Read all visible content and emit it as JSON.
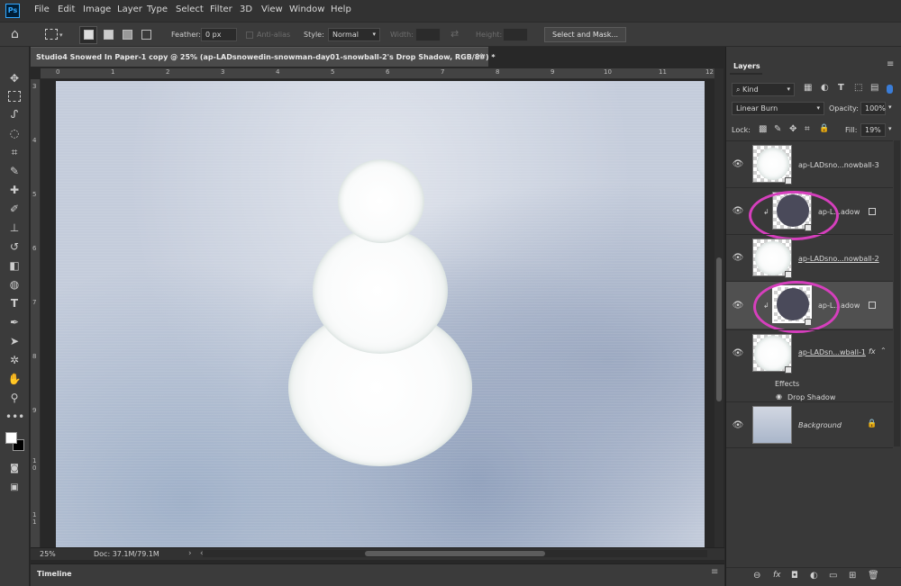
{
  "app": {
    "logo_text": "Ps",
    "menu": [
      "File",
      "Edit",
      "Image",
      "Layer",
      "Type",
      "Select",
      "Filter",
      "3D",
      "View",
      "Window",
      "Help"
    ]
  },
  "options_bar": {
    "feather_label": "Feather:",
    "feather_value": "0 px",
    "antialias_label": "Anti-alias",
    "style_label": "Style:",
    "style_value": "Normal",
    "width_label": "Width:",
    "height_label": "Height:",
    "select_mask_label": "Select and Mask..."
  },
  "document": {
    "tab_title": "Studio4 Snowed In Paper-1 copy @ 25% (ap-LADsnowedin-snowman-day01-snowball-2's Drop Shadow, RGB/8#) *",
    "close_glyph": "×",
    "h_ruler_ticks": [
      "0",
      "1",
      "2",
      "3",
      "4",
      "5",
      "6",
      "7",
      "8",
      "9",
      "10",
      "11",
      "12"
    ],
    "v_ruler_ticks": [
      "3",
      "4",
      "5",
      "6",
      "7",
      "8",
      "9",
      "1\n0",
      "1\n1"
    ],
    "zoom": "25%",
    "doc_size": "Doc: 37.1M/79.1M"
  },
  "timeline": {
    "label": "Timeline"
  },
  "layers_panel": {
    "tab": "Layers",
    "filter_kind": "Kind",
    "blend_mode": "Linear Burn",
    "opacity_label": "Opacity:",
    "opacity_value": "100%",
    "lock_label": "Lock:",
    "fill_label": "Fill:",
    "fill_value": "19%",
    "layers": [
      {
        "name": "ap-LADsno...nowball-3",
        "type": "snowball"
      },
      {
        "name": "ap-L...adow",
        "type": "shadow",
        "highlighted": true
      },
      {
        "name": "ap-LADsno...nowball-2",
        "type": "snowball"
      },
      {
        "name": "ap-L...adow",
        "type": "shadow",
        "highlighted": true,
        "selected": true
      },
      {
        "name": "ap-LADsn...wball-1",
        "type": "snowball",
        "fx": "fx"
      },
      {
        "name": "Background",
        "type": "background"
      }
    ],
    "effects_label": "Effects",
    "drop_shadow_label": "Drop Shadow",
    "highlight_color": "#d63fbd"
  },
  "icons": {
    "eye": "👁",
    "lock": "🔒",
    "fx": "fx",
    "search": "⌕"
  }
}
